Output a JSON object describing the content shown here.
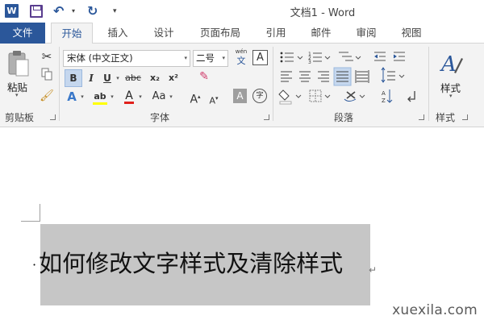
{
  "titlebar": {
    "app_icon_letter": "W",
    "title": "文档1 - Word"
  },
  "tabs": [
    "文件",
    "开始",
    "插入",
    "设计",
    "页面布局",
    "引用",
    "邮件",
    "审阅",
    "视图"
  ],
  "ribbon": {
    "clipboard": {
      "paste_label": "粘贴",
      "group_label": "剪贴板"
    },
    "font": {
      "font_name": "宋体 (中文正文)",
      "font_size": "二号",
      "bold": "B",
      "italic": "I",
      "underline": "U",
      "strike": "abc",
      "subscript": "x₂",
      "superscript": "x²",
      "text_effect": "A",
      "highlight": "ab",
      "font_color": "A",
      "change_case": "Aa",
      "grow_font": "A",
      "shrink_font": "A",
      "char_shading": "A",
      "enclose_char": "字",
      "pinyin_top": "wén",
      "pinyin_bottom": "文",
      "char_border": "A",
      "group_label": "字体"
    },
    "paragraph": {
      "group_label": "段落"
    },
    "styles": {
      "styles_label": "样式",
      "group_label": "样式"
    }
  },
  "colors": {
    "brand": "#2b579a",
    "highlight": "#ffff00",
    "font_color": "#e0201b",
    "selection": "#c6c6c6"
  },
  "document": {
    "bullet": "·",
    "text": "如何修改文字样式及清除样式",
    "paragraph_mark": "↵"
  },
  "watermark": "xuexila.com"
}
